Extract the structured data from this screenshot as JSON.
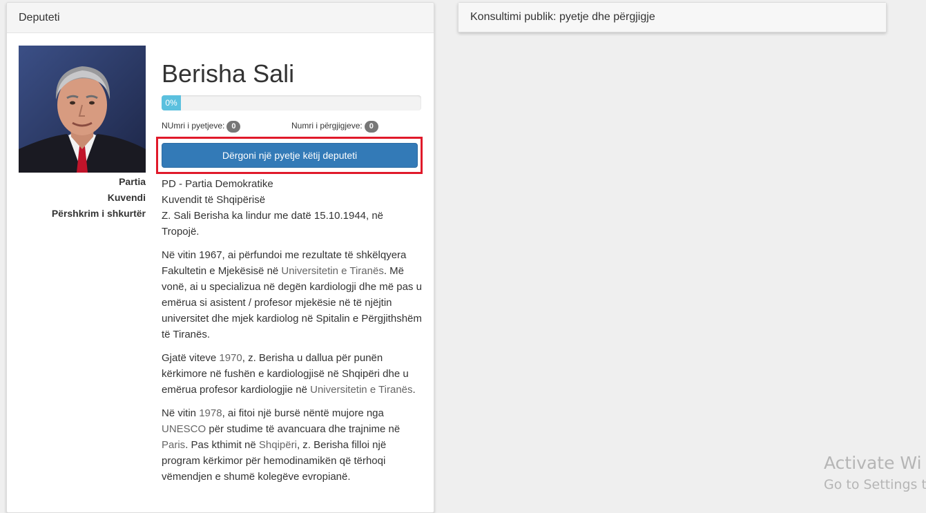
{
  "left_panel": {
    "heading": "Deputeti"
  },
  "right_panel": {
    "heading": "Konsultimi publik: pyetje dhe përgjigje"
  },
  "deputy": {
    "photo_alt": "Berisha Sali",
    "name": "Berisha Sali",
    "progress_label": "0%",
    "progress_value": 0,
    "questions_label": "NUmri i pyetjeve:",
    "questions_count": "0",
    "answers_label": "Numri i përgjigjeve:",
    "answers_count": "0",
    "send_button": "Dërgoni një pyetje këtij deputeti",
    "labels": {
      "party": "Partia",
      "assembly": "Kuvendi",
      "description": "Përshkrim i shkurtër"
    },
    "party_value": "PD - Partia Demokratike",
    "assembly_value": "Kuvendit të Shqipërisë",
    "bio": {
      "p0": "Z. Sali Berisha ka lindur me datë 15.10.1944, në Tropojë.",
      "p1_a": "Në vitin 1967, ai përfundoi me rezultate të shkëlqyera Fakultetin e Mjekësisë në ",
      "p1_link": "Universitetin e Tiranës",
      "p1_b": ". Më vonë, ai u specializua në degën kardiologji dhe më pas u emërua si asistent / profesor mjekësie në të njëjtin universitet dhe mjek kardiolog në Spitalin e Përgjithshëm të Tiranës.",
      "p2_a": "Gjatë viteve ",
      "p2_link1": "1970",
      "p2_b": ", z. Berisha u dallua për punën kërkimore në fushën e kardiologjisë në Shqipëri dhe u emërua profesor kardiologjie në ",
      "p2_link2": "Universitetin e Tiranës",
      "p2_c": ".",
      "p3_a": "Në vitin ",
      "p3_link1": "1978",
      "p3_b": ", ai fitoi një bursë nëntë mujore nga ",
      "p3_link2": "UNESCO",
      "p3_c": " për studime të avancuara dhe trajnime në ",
      "p3_link3": "Paris",
      "p3_d": ". Pas kthimit në ",
      "p3_link4": "Shqipëri",
      "p3_e": ", z. Berisha filloi një program kërkimor për hemodinamikën që tërhoqi vëmendjen e shumë kolegëve evropianë."
    }
  },
  "watermark": {
    "title": "Activate Wi",
    "subtitle": "Go to Settings t"
  }
}
